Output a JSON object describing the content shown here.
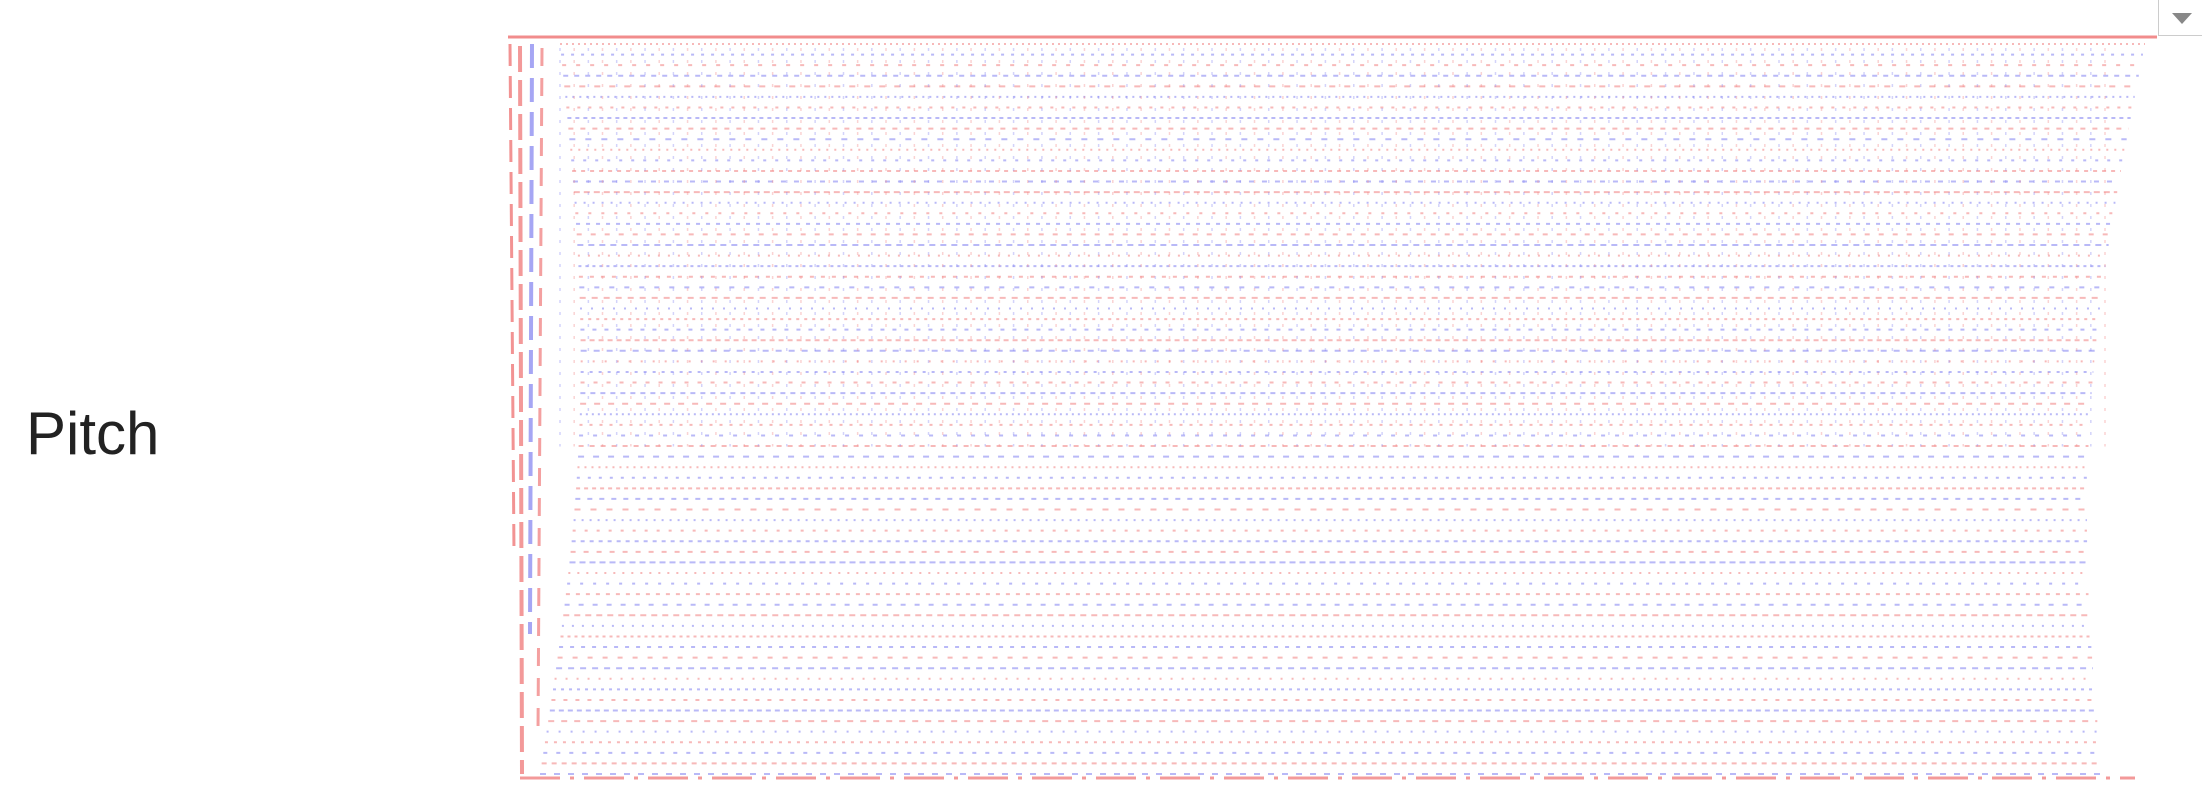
{
  "param": {
    "label": "Pitch"
  },
  "plot": {
    "pattern": "moire-dotted-lines",
    "colors": {
      "red": "#f08080",
      "blue": "#8080f0"
    }
  },
  "dropdown": {
    "icon": "chevron-down-icon"
  }
}
